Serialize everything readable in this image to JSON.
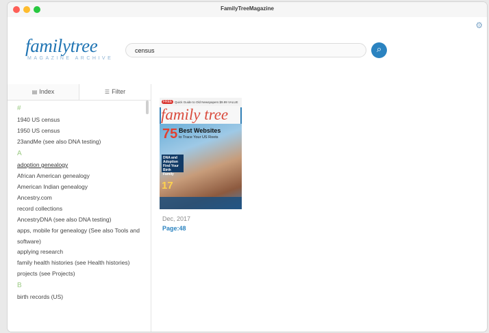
{
  "window": {
    "title": "FamilyTreeMagazine"
  },
  "icons": {
    "settings": "gear-icon",
    "search": "magnifier-icon",
    "index": "list-icon",
    "filter": "sliders-icon"
  },
  "colors": {
    "accent": "#2b83c0",
    "letter": "#9ccb84"
  },
  "logo": {
    "word": "familytree",
    "subtitle": "MAGAZINE ARCHIVE"
  },
  "search": {
    "value": "census"
  },
  "tabs": {
    "index": "Index",
    "filter": "Filter"
  },
  "index": {
    "sections": [
      {
        "letter": "#",
        "entries": [
          "1940 US census",
          "1950 US census",
          "23andMe (see also DNA testing)"
        ]
      },
      {
        "letter": "A",
        "entries": [
          "adoption genealogy",
          "African American genealogy",
          "American Indian genealogy",
          "Ancestry.com",
          "record collections",
          "AncestryDNA (see also DNA testing)",
          "apps, mobile for genealogy (See also Tools and software)",
          "applying research",
          "family health histories (see Health histories)",
          "projects (see Projects)"
        ]
      },
      {
        "letter": "B",
        "entries": [
          "birth records (US)"
        ]
      }
    ]
  },
  "result": {
    "cover": {
      "free_badge": "FREE",
      "blurb": "Quick Guide to Old Newspapers  $9.99 VALUE",
      "title": "family tree",
      "big_number": "75",
      "headline": "Best Websites",
      "subhead": "to Trace Your US Roots",
      "box": "DNA and Adoption Find Your Birth Family",
      "number_17": "17"
    },
    "date": "Dec, 2017",
    "page": "Page:48"
  }
}
